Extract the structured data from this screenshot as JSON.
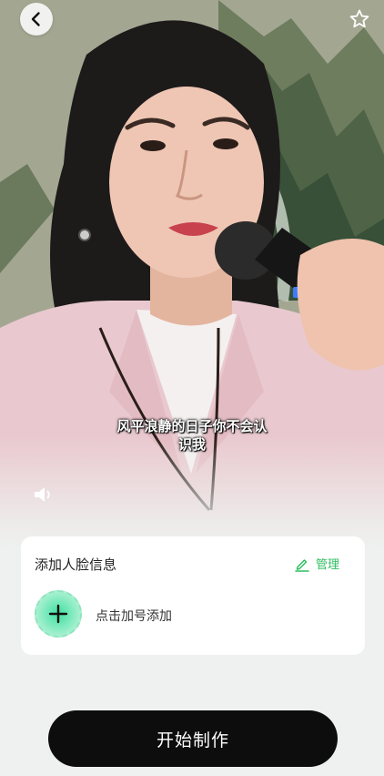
{
  "video": {
    "subtitle_line1": "风平浪静的日子你不会认",
    "subtitle_line2": "识我"
  },
  "icons": {
    "back": "chevron-left-icon",
    "favorite": "star-outline-icon",
    "sound": "speaker-icon",
    "manage": "edit-pencil-icon",
    "add": "plus-icon"
  },
  "face_card": {
    "title": "添加人脸信息",
    "manage_label": "管理",
    "add_label": "点击加号添加"
  },
  "actions": {
    "start_label": "开始制作"
  },
  "colors": {
    "accent_green": "#2fbf62",
    "button_black": "#0d0d0d",
    "background": "#eef1ef"
  }
}
